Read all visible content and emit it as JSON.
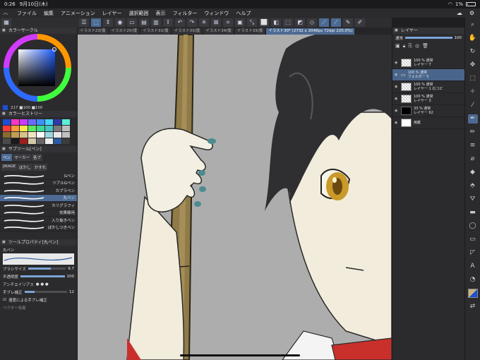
{
  "status": {
    "time": "0:26",
    "date": "9月10日(木)",
    "battery": "1%"
  },
  "menu": {
    "items": [
      "ファイル",
      "編集",
      "アニメーション",
      "レイヤー",
      "選択範囲",
      "表示",
      "フィルター",
      "ウィンドウ",
      "ヘルプ"
    ]
  },
  "tabs": {
    "items": [
      "イラスト23(復",
      "イラスト25(復",
      "イラスト31(復",
      "イラスト33(復",
      "イラスト34(復",
      "イラスト33(復"
    ],
    "active": "イラスト30* (2732 x 2048px 72dpi 220.0%)"
  },
  "panels": {
    "color_circle": "カラーサークル",
    "color_values": "217 ■100 ■100",
    "color_history": "カラーヒストリー",
    "subtool": "サブツール[ペン]",
    "tool_property": "ツールプロパティ[丸ペン]",
    "layer": "レイヤー"
  },
  "subtool_tabs": [
    "ペン",
    "マーカー",
    "各ブ",
    "JIKAGE",
    "ぼかし",
    "かすれ"
  ],
  "brushes": [
    "Gペン",
    "ツアルGペン",
    "カブラペン",
    "丸ペン",
    "カリグラフィ",
    "効果線用",
    "入り抜きペン",
    "ぼかしつきペン"
  ],
  "brush_selected_index": 3,
  "properties": {
    "brush_name": "丸ペン",
    "size_label": "ブラシサイズ",
    "size_value": "9.7",
    "opacity_label": "不透明度",
    "opacity_value": "100",
    "aa_label": "アンチエイリアス",
    "stabilize_label": "手ブレ補正",
    "stabilize_value": "12",
    "speed_label": "速度による手ブレ補正",
    "vector_label": "ベクター吸着",
    "size_fraction": 0.6,
    "opacity_fraction": 1.0,
    "stabilize_fraction": 0.24
  },
  "layers": [
    {
      "line1": "100 % 通常",
      "line2": "レイヤー 7"
    },
    {
      "line1": "100 % 通常",
      "line2": "フォルダー 5"
    },
    {
      "line1": "100 % 通常",
      "line2": "レイヤー 1 のコピ"
    },
    {
      "line1": "100 % 通常",
      "line2": "レイヤー 3"
    },
    {
      "line1": "33 % 通常",
      "line2": "レイヤー 62"
    },
    {
      "line1": "",
      "line2": "用紙"
    }
  ],
  "layer_selected_index": 1,
  "layer_blend": "通常",
  "layer_opacity": "100",
  "colors": {
    "accent": "#4c6a93",
    "canvas_bg": "#adadad"
  }
}
